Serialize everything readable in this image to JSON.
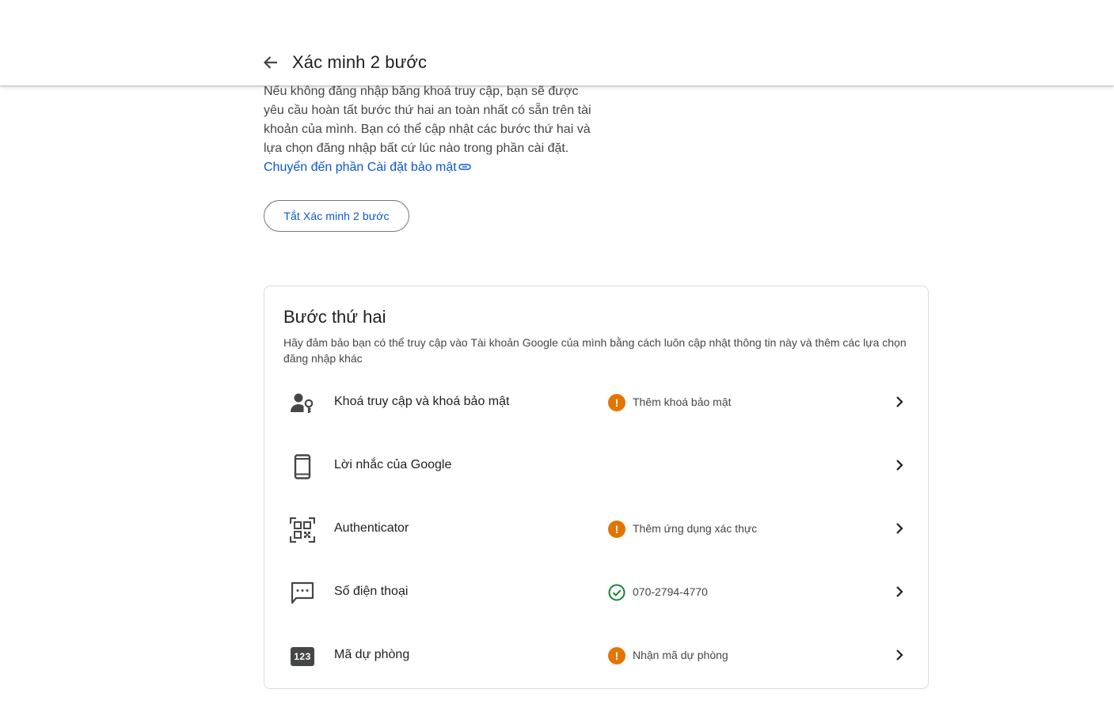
{
  "header": {
    "title": "Xác minh 2 bước",
    "back_icon": "arrow-back-icon"
  },
  "intro": {
    "text": "Nếu không đăng nhập bằng khoá truy cập, bạn sẽ được yêu cầu hoàn tất bước thứ hai an toàn nhất có sẵn trên tài khoản của mình. Bạn có thể cập nhật các bước thứ hai và lựa chọn đăng nhập bất cứ lúc nào trong phần cài đặt.",
    "link_label": "Chuyển đến phần Cài đặt bảo mật",
    "link_icon": "link-icon"
  },
  "turn_off_button": "Tắt Xác minh 2 bước",
  "second_step": {
    "title": "Bước thứ hai",
    "description": "Hãy đảm bảo bạn có thể truy cập vào Tài khoản Google của mình bằng cách luôn cập nhật thông tin này và thêm các lựa chọn đăng nhập khác",
    "items": [
      {
        "label": "Khoá truy cập và khoá bảo mật",
        "icon": "passkey-icon",
        "status": "Thêm khoá bảo mật",
        "status_icon": "warning-icon"
      },
      {
        "label": "Lời nhắc của Google",
        "icon": "phone-icon",
        "status": "",
        "status_icon": ""
      },
      {
        "label": "Authenticator",
        "icon": "qr-code-icon",
        "status": "Thêm ứng dụng xác thực",
        "status_icon": "warning-icon"
      },
      {
        "label": "Số điện thoại",
        "icon": "sms-icon",
        "status": "070-2794-4770",
        "status_icon": "check-circle-icon"
      },
      {
        "label": "Mã dự phòng",
        "icon": "backup-codes-icon",
        "icon_text": "123",
        "status": "Nhận mã dự phòng",
        "status_icon": "warning-icon"
      }
    ]
  },
  "colors": {
    "accent": "#0b57d0",
    "warning": "#e37400",
    "success": "#188038",
    "text_secondary": "#444746",
    "border": "#dadce0"
  }
}
